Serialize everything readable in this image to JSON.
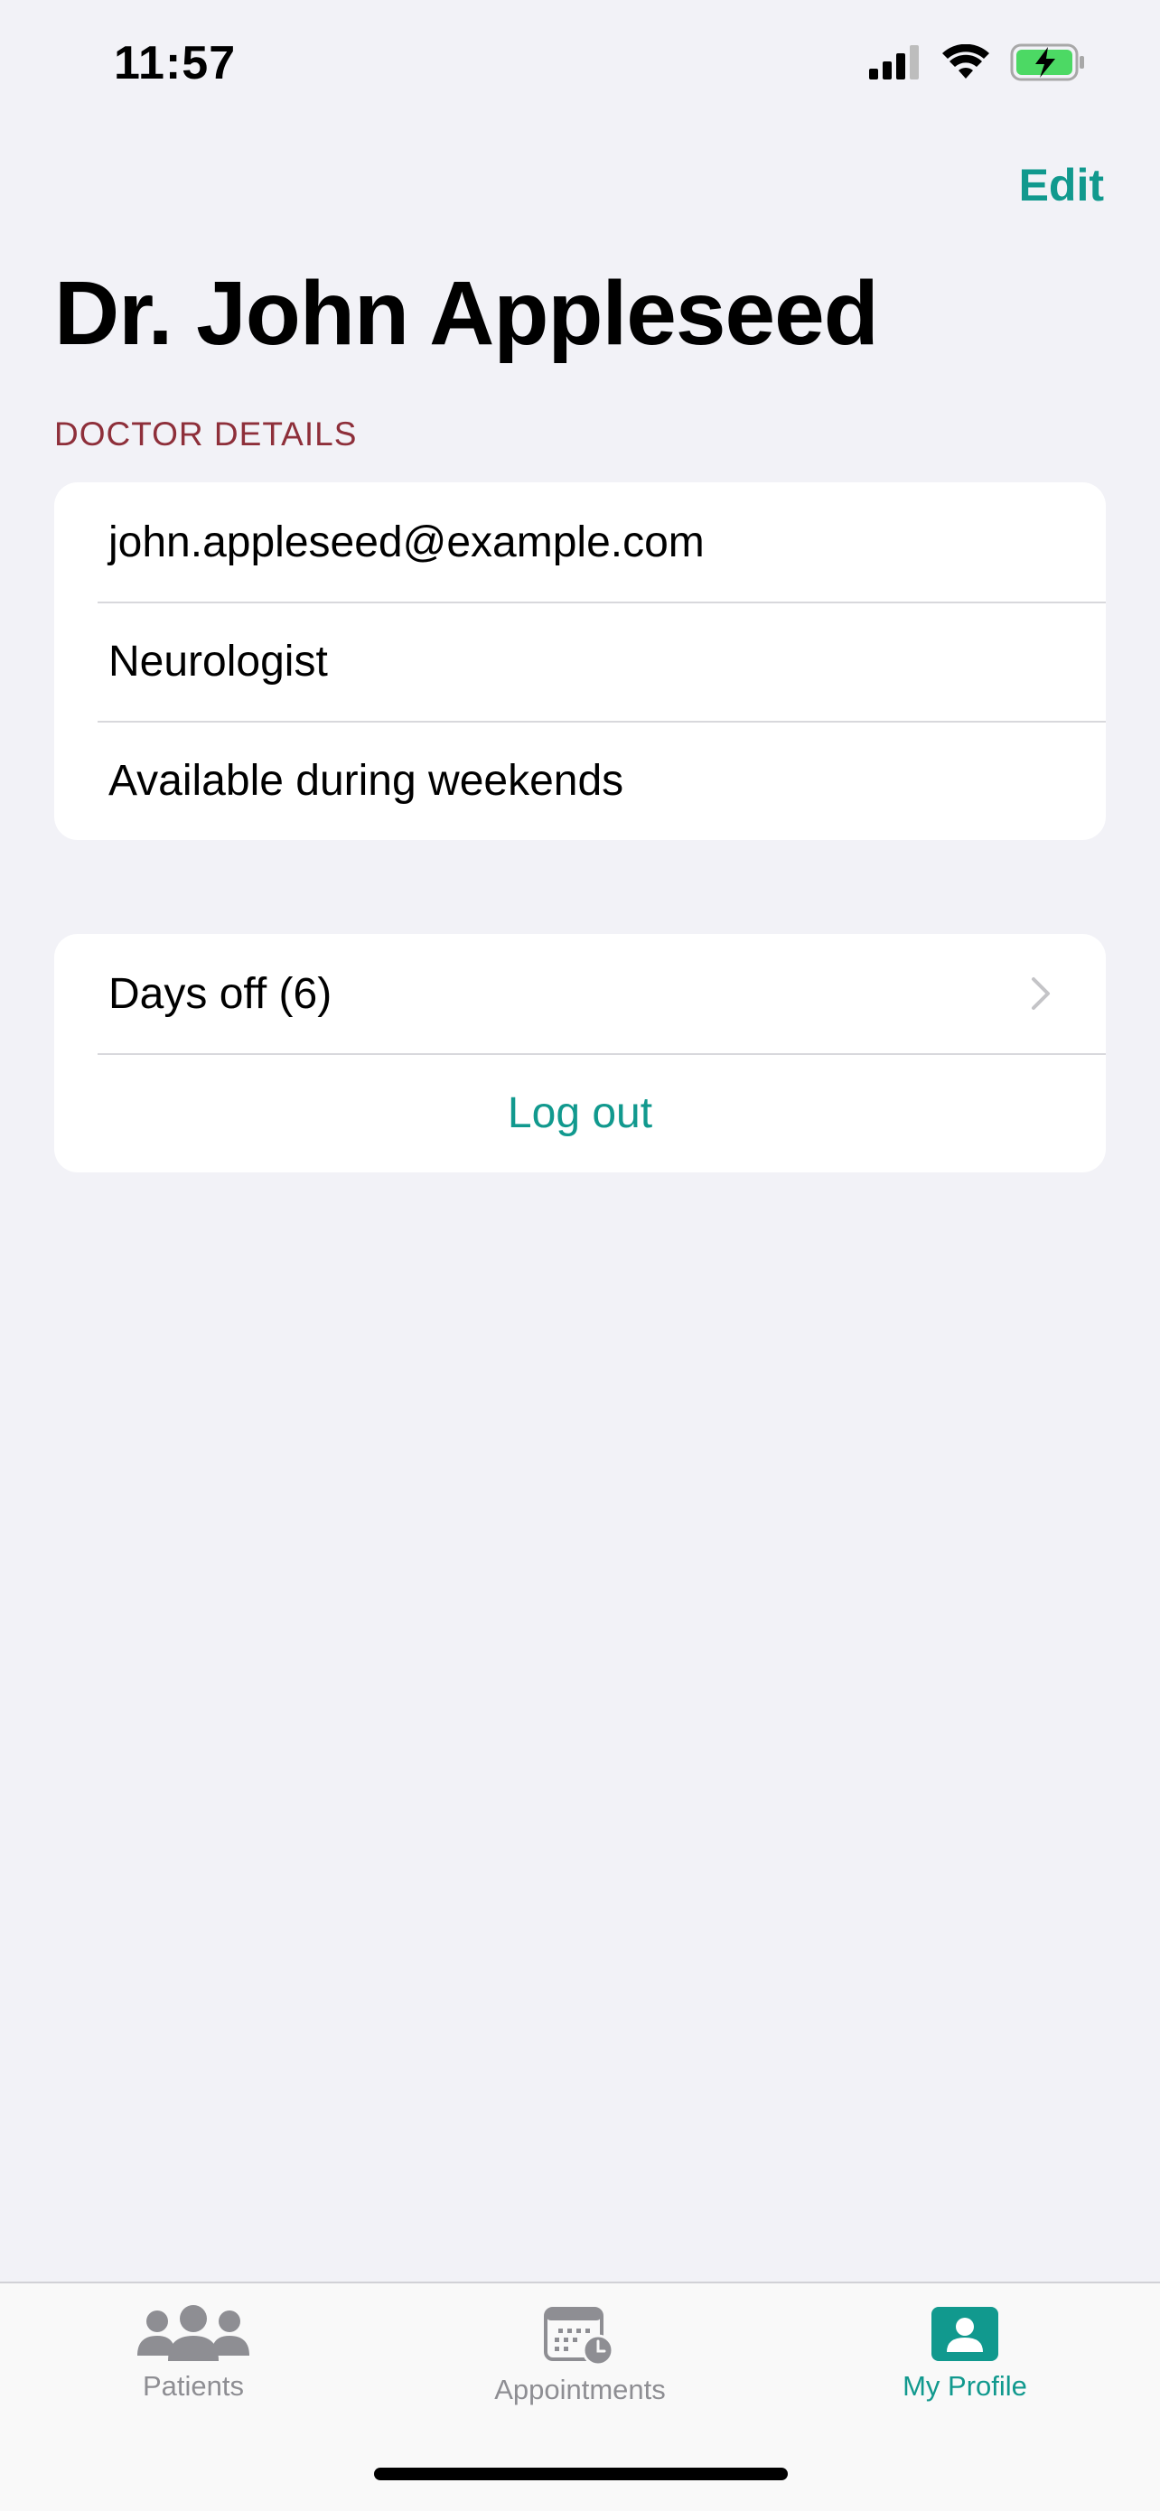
{
  "status_bar": {
    "time": "11:57",
    "icons": [
      "cellular-signal-icon",
      "wifi-icon",
      "battery-charging-icon"
    ]
  },
  "nav": {
    "edit_label": "Edit",
    "title": "Dr. John Appleseed"
  },
  "doctor_details": {
    "header": "DOCTOR DETAILS",
    "email": "john.appleseed@example.com",
    "specialty": "Neurologist",
    "availability": "Available during weekends"
  },
  "actions": {
    "days_off_label": "Days off (6)",
    "logout_label": "Log out"
  },
  "tab_bar": {
    "tabs": [
      {
        "label": "Patients",
        "icon": "people-icon",
        "active": false
      },
      {
        "label": "Appointments",
        "icon": "calendar-clock-icon",
        "active": false
      },
      {
        "label": "My Profile",
        "icon": "profile-card-icon",
        "active": true
      }
    ]
  },
  "colors": {
    "accent": "#11998E",
    "section_header": "#8E2F3A",
    "background": "#F2F2F7",
    "inactive_tab": "#8E8E93",
    "battery_fill": "#4CD964"
  }
}
